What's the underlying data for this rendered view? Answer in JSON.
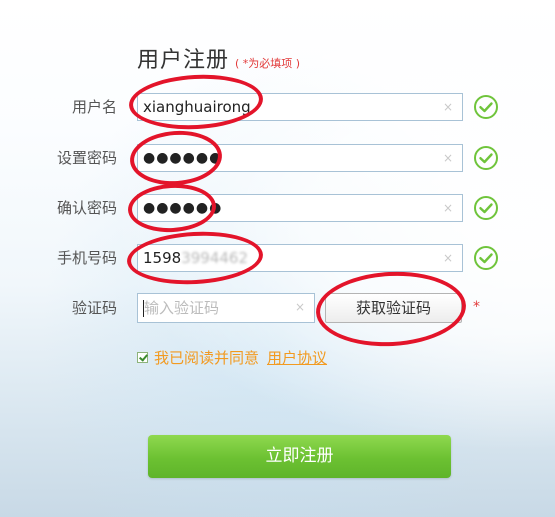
{
  "form": {
    "title": "用户注册",
    "required_note": "( *为必填项 )",
    "fields": [
      {
        "label": "用户名",
        "value": "xianghuairong",
        "clear": "×"
      },
      {
        "label": "设置密码",
        "value": "●●●●●●",
        "clear": "×"
      },
      {
        "label": "确认密码",
        "value": "●●●●●●",
        "clear": "×"
      },
      {
        "label": "手机号码",
        "value_visible": "1598",
        "value_blurred": "3994462",
        "clear": "×"
      }
    ],
    "captcha": {
      "label": "验证码",
      "placeholder": "输入验证码",
      "clear": "×",
      "button_label": "获取验证码",
      "required_mark": "*"
    },
    "agreement": {
      "checked": true,
      "text": "我已阅读并同意",
      "link_text": "用户协议"
    },
    "submit_label": "立即注册"
  },
  "icons": {
    "valid": "check-circle-icon",
    "clear": "clear-x-icon"
  },
  "colors": {
    "valid_green": "#6fc43b",
    "button_green": "#6cc132",
    "link_orange": "#f29a20",
    "required_red": "#e23a3a",
    "annotation_red": "#e3142a"
  }
}
